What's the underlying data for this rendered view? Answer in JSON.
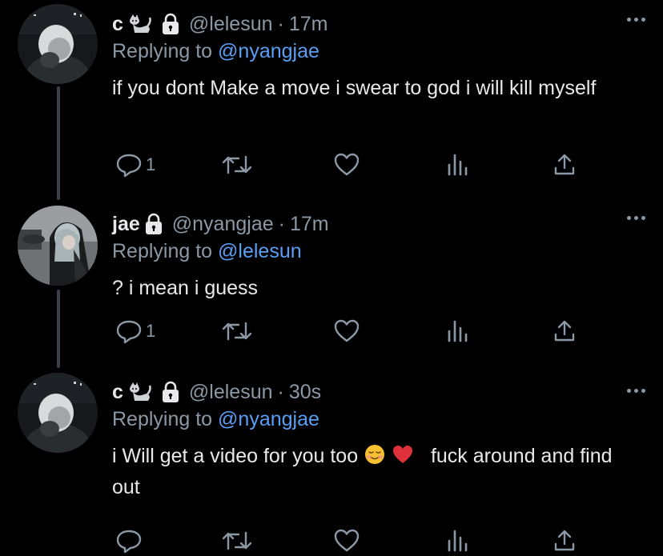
{
  "colors": {
    "background": "#000000",
    "text_primary": "#e7e9ea",
    "text_secondary": "#8b98a5",
    "mention": "#5a9ff5",
    "thread_line": "#3b4046"
  },
  "icons": {
    "reply": "speech-bubble-icon",
    "retweet": "retweet-arrows-icon",
    "like": "heart-outline-icon",
    "analytics": "bar-chart-icon",
    "share": "upload-share-icon",
    "protected": "lock-icon",
    "more": "ellipsis-icon"
  },
  "tweets": [
    {
      "name": "c",
      "handle": "@lelesun",
      "separator": "·",
      "time": "17m",
      "replying_prefix": "Replying to",
      "replying_to": "@nyangjae",
      "text": "if you dont Make a move i swear to god i will kill myself",
      "reply_count": "1",
      "has_cat_emoji": true
    },
    {
      "name": "jae",
      "handle": "@nyangjae",
      "separator": "·",
      "time": "17m",
      "replying_prefix": "Replying to",
      "replying_to": "@lelesun",
      "text": "? i mean i guess",
      "reply_count": "1",
      "has_cat_emoji": false
    },
    {
      "name": "c",
      "handle": "@lelesun",
      "separator": "·",
      "time": "30s",
      "replying_prefix": "Replying to",
      "replying_to": "@nyangjae",
      "text_part1": "i Will get a video for you too",
      "text_part2": "fuck around and find out",
      "reply_count": "",
      "has_cat_emoji": true
    }
  ]
}
